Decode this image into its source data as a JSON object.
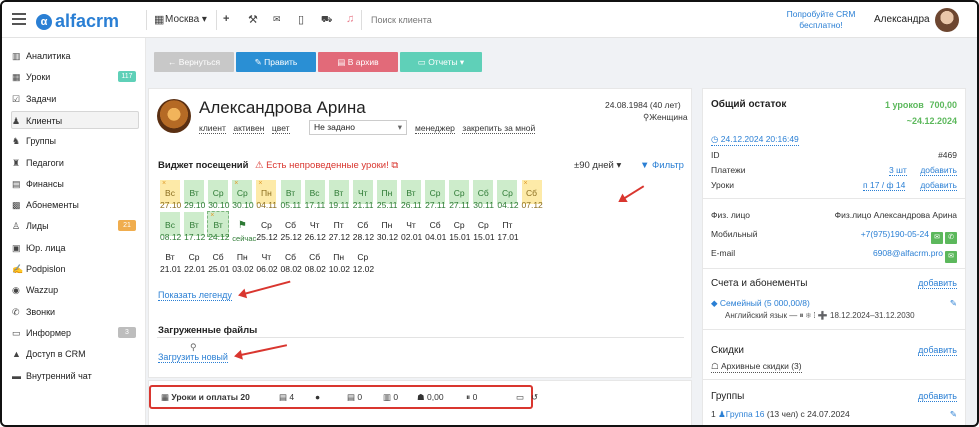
{
  "topbar": {
    "logo": "alfacrm",
    "city": "Москва",
    "search_placeholder": "Поиск клиента",
    "promo": "Попробуйте CRM бесплатно!",
    "user": "Александра"
  },
  "sidebar": {
    "items": [
      {
        "label": "Аналитика",
        "icon": "chart-icon"
      },
      {
        "label": "Уроки",
        "icon": "calendar-icon",
        "badge": "117"
      },
      {
        "label": "Задачи",
        "icon": "tasks-icon"
      },
      {
        "label": "Клиенты",
        "icon": "client-icon"
      },
      {
        "label": "Группы",
        "icon": "groups-icon"
      },
      {
        "label": "Педагоги",
        "icon": "teacher-icon"
      },
      {
        "label": "Финансы",
        "icon": "money-icon"
      },
      {
        "label": "Абонементы",
        "icon": "subscription-icon"
      },
      {
        "label": "Лиды",
        "icon": "leads-icon",
        "badge": "21"
      },
      {
        "label": "Юр. лица",
        "icon": "company-icon"
      },
      {
        "label": "Podpislon",
        "icon": "sign-icon"
      },
      {
        "label": "Wazzup",
        "icon": "chat-icon"
      },
      {
        "label": "Звонки",
        "icon": "phone-icon"
      },
      {
        "label": "Информер",
        "icon": "informer-icon",
        "badge": "3"
      },
      {
        "label": "Доступ в CRM",
        "icon": "lock-icon"
      },
      {
        "label": "Внутренний чат",
        "icon": "message-icon"
      }
    ]
  },
  "actions": {
    "back": "← Вернуться",
    "edit": "✎ Править",
    "archive": "▤ В архив",
    "reports": "▭ Отчеты ▾"
  },
  "client": {
    "name": "Александрова Арина",
    "dob": "24.08.1984 (40 лет)",
    "gender": "Женщина",
    "chip_client": "клиент",
    "chip_active": "активен",
    "chip_color": "цвет",
    "select_value": "Не задано",
    "manager": "менеджер",
    "pin": "закрепить за мной"
  },
  "widget": {
    "title": "Виджет посещений",
    "warning": "Есть непроведенные уроки!",
    "range": "±90 дней",
    "filter": "Фильтр",
    "legend_link": "Показать легенду",
    "cells": [
      [
        "y",
        "Вс",
        "27.10",
        true
      ],
      [
        "g",
        "Вт",
        "29.10",
        false
      ],
      [
        "g",
        "Ср",
        "30.10",
        false
      ],
      [
        "g",
        "Ср",
        "30.10",
        true
      ],
      [
        "y",
        "Пн",
        "04.11",
        true
      ],
      [
        "g",
        "Вт",
        "05.11",
        false
      ],
      [
        "g",
        "Вс",
        "17.11",
        false
      ],
      [
        "g",
        "Вт",
        "19.11",
        false
      ],
      [
        "g",
        "Чт",
        "21.11",
        false
      ],
      [
        "g",
        "Пн",
        "25.11",
        false
      ],
      [
        "g",
        "Вт",
        "26.11",
        false
      ],
      [
        "g",
        "Ср",
        "27.11",
        false
      ],
      [
        "g",
        "Ср",
        "27.11",
        false
      ],
      [
        "g",
        "Сб",
        "30.11",
        false
      ],
      [
        "g",
        "Ср",
        "04.12",
        false
      ],
      [
        "y",
        "Сб",
        "07.12",
        true
      ],
      [
        "g",
        "Вс",
        "08.12",
        false
      ],
      [
        "g",
        "Вт",
        "17.12",
        false
      ],
      [
        "gd",
        "Вт",
        "24.12",
        true
      ],
      [
        "now",
        "сейчас",
        "",
        false
      ],
      [
        "w",
        "Ср",
        "25.12",
        false
      ],
      [
        "w",
        "Сб",
        "25.12",
        false
      ],
      [
        "w",
        "Чт",
        "26.12",
        false
      ],
      [
        "w",
        "Пт",
        "27.12",
        false
      ],
      [
        "w",
        "Сб",
        "28.12",
        false
      ],
      [
        "w",
        "Пн",
        "30.12",
        false
      ],
      [
        "w",
        "Чт",
        "02.01",
        false
      ],
      [
        "w",
        "Сб",
        "04.01",
        false
      ],
      [
        "w",
        "Ср",
        "15.01",
        false
      ],
      [
        "w",
        "Ср",
        "15.01",
        false
      ],
      [
        "w",
        "Пт",
        "17.01",
        false
      ],
      [
        "w",
        "Вт",
        "21.01",
        false
      ],
      [
        "w",
        "Ср",
        "22.01",
        false
      ],
      [
        "w",
        "Сб",
        "25.01",
        false
      ],
      [
        "w",
        "Пн",
        "03.02",
        false
      ],
      [
        "w",
        "Чт",
        "06.02",
        false
      ],
      [
        "w",
        "Сб",
        "08.02",
        false
      ],
      [
        "w",
        "Сб",
        "08.02",
        false
      ],
      [
        "w",
        "Пн",
        "10.02",
        false
      ],
      [
        "w",
        "Ср",
        "12.02",
        false
      ]
    ]
  },
  "files": {
    "title": "Загруженные файлы",
    "upload": "Загрузить новый"
  },
  "tabs": [
    {
      "label": "Уроки и оплаты 20",
      "icon": "lessons-icon"
    },
    {
      "label": "4",
      "icon": "copy-icon"
    },
    {
      "label": "",
      "icon": "chat-bubble-icon"
    },
    {
      "label": "0",
      "icon": "doc-icon"
    },
    {
      "label": "0",
      "icon": "stats-icon"
    },
    {
      "label": "0,00",
      "icon": "bonus-icon"
    },
    {
      "label": "0",
      "icon": "pause-icon"
    },
    {
      "label": "",
      "icon": "card-icon"
    },
    {
      "label": "",
      "icon": "history-icon"
    }
  ],
  "summary": {
    "title": "Общий остаток",
    "lessons": "1 уроков",
    "amount": "700,00",
    "to_date": "~24.12.2024",
    "updated": "24.12.2024 20:16:49",
    "id_label": "ID",
    "id_value": "#469",
    "payments_label": "Платежи",
    "payments_value": "3 шт",
    "lessons_label": "Уроки",
    "lessons_value": "п 17 / ф 14",
    "add": "добавить",
    "person_label": "Физ. лицо",
    "person_value": "Физ.лицо Александрова Арина",
    "mobile_label": "Мобильный",
    "mobile_value": "+7(975)190-05-24",
    "email_label": "E-mail",
    "email_value": "6908@alfacrm.pro"
  },
  "accounts": {
    "title": "Счета и абонементы",
    "add": "добавить",
    "plan": "Семейный (5 000,00/8)",
    "detail": "Английский язык — ⏸ ❄ ⁞ ➕  18.12.2024–31.12.2030"
  },
  "discounts": {
    "title": "Скидки",
    "add": "добавить",
    "archive": "Архивные скидки (3)"
  },
  "groups": {
    "title": "Группы",
    "add": "добавить",
    "item_num": "1",
    "item": "Группа 16",
    "item_tail": "(13 чел) с 24.07.2024"
  },
  "colors": {
    "primary": "#2a7fd4",
    "green": "#5cb85c",
    "red": "#d9362f",
    "gray_button": "#c8c8c8",
    "edit_button": "#2a8fd4",
    "archive_button": "#e26a79",
    "reports_button": "#5fd0b8",
    "attended": "#cdeccb",
    "missed": "#fdeaa8"
  }
}
